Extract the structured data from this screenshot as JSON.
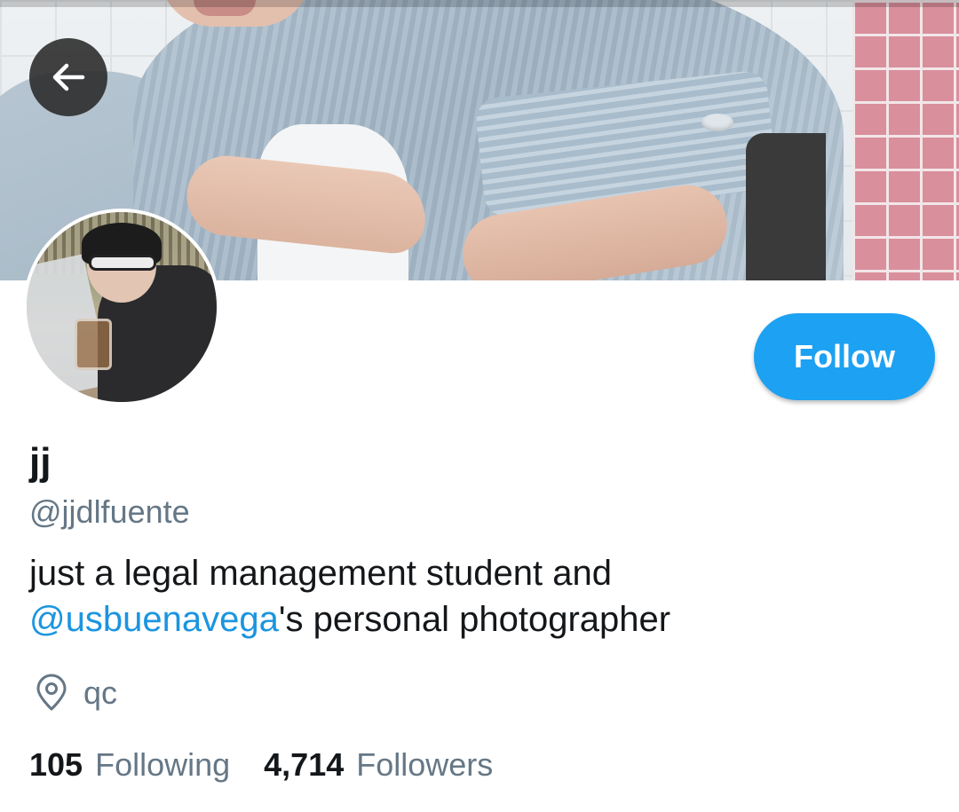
{
  "profile": {
    "name": "jj",
    "handle": "@jjdlfuente",
    "bio_line1": "just a legal management student and",
    "bio_mention": "@usbuenavega",
    "bio_line2_rest": "'s personal photographer",
    "location": "qc"
  },
  "actions": {
    "follow_label": "Follow"
  },
  "stats": {
    "following_count": "105",
    "following_label": "Following",
    "followers_count": "4,714",
    "followers_label": "Followers"
  },
  "colors": {
    "accent": "#1da1f2",
    "mention": "#1b95e0",
    "secondary_text": "#657786",
    "primary_text": "#14171a"
  },
  "icons": {
    "back": "arrow-left-icon",
    "location": "map-pin-icon"
  }
}
